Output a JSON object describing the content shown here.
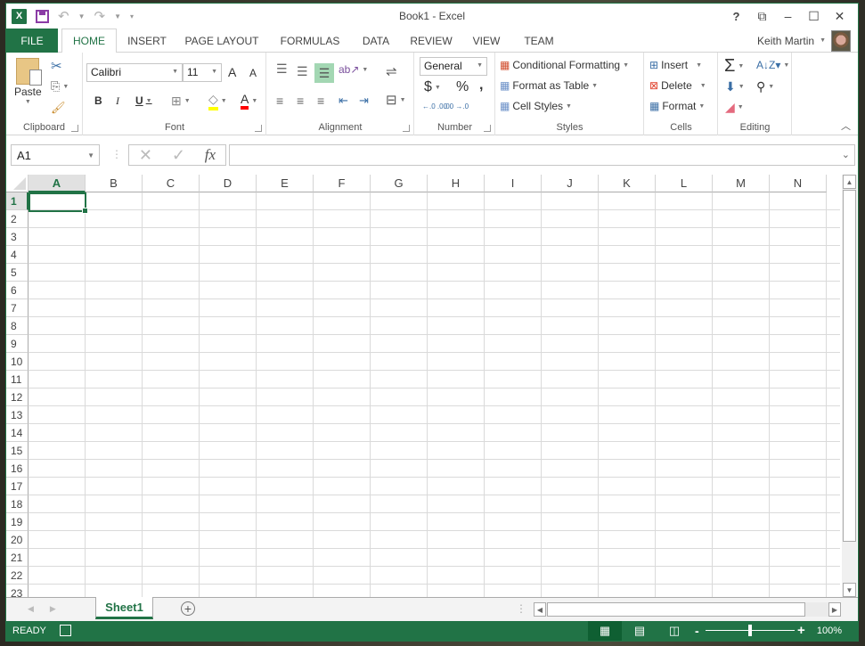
{
  "window": {
    "title": "Book1 - Excel",
    "controls": {
      "help": "?",
      "restore_ribbon": "⧉",
      "minimize": "–",
      "maximize": "☐",
      "close": "✕"
    }
  },
  "qat": {
    "logo": "X",
    "undo": "↶",
    "redo": "↷",
    "customize": "▾"
  },
  "tabs": [
    {
      "label": "FILE"
    },
    {
      "label": "HOME"
    },
    {
      "label": "INSERT"
    },
    {
      "label": "PAGE LAYOUT"
    },
    {
      "label": "FORMULAS"
    },
    {
      "label": "DATA"
    },
    {
      "label": "REVIEW"
    },
    {
      "label": "VIEW"
    },
    {
      "label": "TEAM"
    }
  ],
  "user": {
    "name": "Keith Martin"
  },
  "ribbon": {
    "clipboard": {
      "label": "Clipboard",
      "paste": "Paste"
    },
    "font": {
      "label": "Font",
      "font_name": "Calibri",
      "font_size": "11",
      "bold": "B",
      "italic": "I",
      "underline": "U",
      "grow": "A",
      "shrink": "A",
      "font_color": "A",
      "fill_color_hex": "#ffff00",
      "font_color_hex": "#ff0000"
    },
    "alignment": {
      "label": "Alignment"
    },
    "number": {
      "label": "Number",
      "format": "General",
      "currency": "$",
      "percent": "%",
      "comma": ",",
      "inc_decimal": "←.0 .00",
      "dec_decimal": ".00 →.0"
    },
    "styles": {
      "label": "Styles",
      "conditional": "Conditional Formatting",
      "format_table": "Format as Table",
      "cell_styles": "Cell Styles"
    },
    "cells": {
      "label": "Cells",
      "insert": "Insert",
      "delete": "Delete",
      "format": "Format"
    },
    "editing": {
      "label": "Editing",
      "autosum": "Σ"
    }
  },
  "formula_bar": {
    "name_box": "A1",
    "cancel": "✕",
    "enter": "✓",
    "fx": "fx",
    "value": ""
  },
  "grid": {
    "columns": [
      "A",
      "B",
      "C",
      "D",
      "E",
      "F",
      "G",
      "H",
      "I",
      "J",
      "K",
      "L",
      "M",
      "N"
    ],
    "rows": [
      "1",
      "2",
      "3",
      "4",
      "5",
      "6",
      "7",
      "8",
      "9",
      "10",
      "11",
      "12",
      "13",
      "14",
      "15",
      "16",
      "17",
      "18",
      "19",
      "20",
      "21",
      "22",
      "23"
    ],
    "active_cell": "A1"
  },
  "sheets": [
    {
      "name": "Sheet1",
      "active": true
    }
  ],
  "status": {
    "mode": "READY",
    "zoom": "100%",
    "zoom_level": 100
  },
  "colors": {
    "brand_green": "#217346",
    "selected_header": "#e1e1e1"
  }
}
